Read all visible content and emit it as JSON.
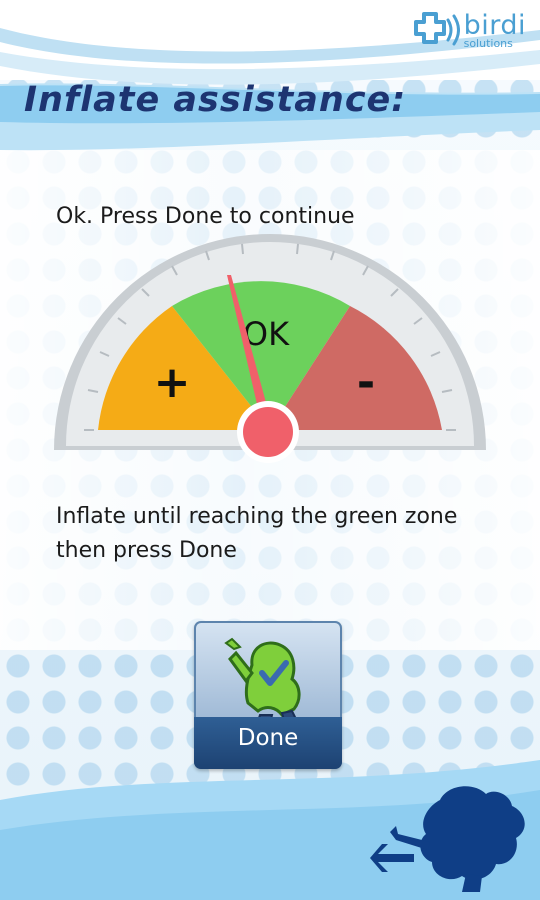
{
  "brand": {
    "name": "birdi",
    "subtitle": "solutions",
    "accent_color": "#4a9fd2"
  },
  "header": {
    "title": "Inflate assistance:"
  },
  "status": {
    "message": "Ok. Press Done to continue"
  },
  "gauge": {
    "zones": [
      {
        "label": "+",
        "color": "#f5ab16"
      },
      {
        "label": "OK",
        "color": "#6cd15c"
      },
      {
        "label": "-",
        "color": "#cf6a64"
      }
    ],
    "needle_color": "#f0606a",
    "current_zone": "OK"
  },
  "instructions": {
    "text": "Inflate until reaching the green zone then press Done"
  },
  "done_button": {
    "label": "Done",
    "icon": "mascot-check-icon"
  },
  "back_button": {
    "icon": "back-arrow-mascot-icon"
  }
}
